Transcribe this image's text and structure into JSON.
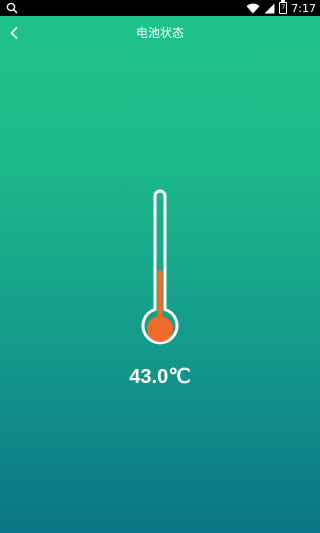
{
  "status_bar": {
    "time": "7:17",
    "battery_level": "7",
    "icons": [
      "search-icon",
      "wifi-icon",
      "signal-icon",
      "battery-icon"
    ]
  },
  "header": {
    "title": "电池状态",
    "back_icon": "chevron-left-icon"
  },
  "battery_status": {
    "temperature": "43.0℃",
    "thermometer_fill_fraction": 0.43
  },
  "colors": {
    "background_top": "#1fc388",
    "background_bottom": "#0b7587",
    "mercury": "#f26b2a",
    "thermometer_outline": "#ffffff"
  }
}
